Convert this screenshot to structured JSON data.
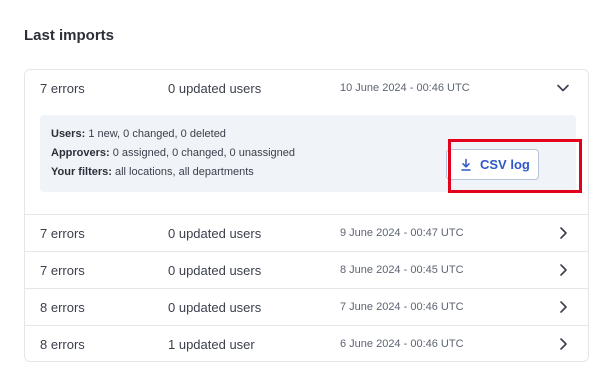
{
  "section_title": "Last imports",
  "expanded_import": {
    "errors": "7 errors",
    "updated": "0 updated users",
    "timestamp": "10 June 2024 - 00:46 UTC",
    "details": {
      "users_label": "Users:",
      "users_value": "1 new, 0 changed, 0 deleted",
      "approvers_label": "Approvers:",
      "approvers_value": "0 assigned, 0 changed, 0 unassigned",
      "filters_label": "Your filters:",
      "filters_value": "all locations, all departments"
    },
    "csv_button_label": "CSV log",
    "csv_icon": "download-icon"
  },
  "imports": [
    {
      "errors": "7 errors",
      "updated": "0 updated users",
      "timestamp": "9 June 2024 - 00:47 UTC"
    },
    {
      "errors": "7 errors",
      "updated": "0 updated users",
      "timestamp": "8 June 2024 - 00:45 UTC"
    },
    {
      "errors": "8 errors",
      "updated": "0 updated users",
      "timestamp": "7 June 2024 - 00:46 UTC"
    },
    {
      "errors": "8 errors",
      "updated": "1 updated user",
      "timestamp": "6 June 2024 - 00:46 UTC"
    }
  ],
  "colors": {
    "accent": "#2f59c9",
    "highlight": "#e3001b",
    "details_bg": "#f0f3f7",
    "border": "#e4e6ea"
  }
}
